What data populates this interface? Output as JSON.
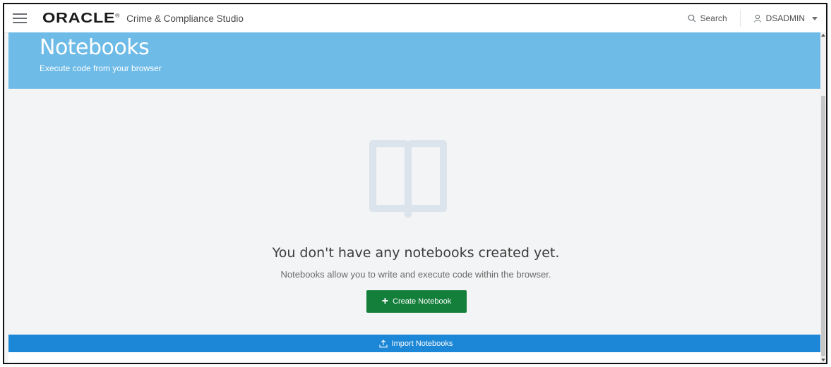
{
  "header": {
    "brand_logo": "ORACLE",
    "brand_mark": "®",
    "product_name": "Crime & Compliance Studio",
    "search_label": "Search",
    "user_label": "DSADMIN"
  },
  "hero": {
    "title": "Notebooks",
    "subtitle": "Execute code from your browser",
    "color": "#6ebbe7"
  },
  "empty_state": {
    "icon": "open-book-icon",
    "title": "You don't have any notebooks created yet.",
    "description": "Notebooks allow you to write and execute code within the browser.",
    "create_button_label": "Create Notebook",
    "create_button_color": "#137f3a"
  },
  "import_bar": {
    "label": "Import Notebooks",
    "color": "#1c87d6"
  }
}
